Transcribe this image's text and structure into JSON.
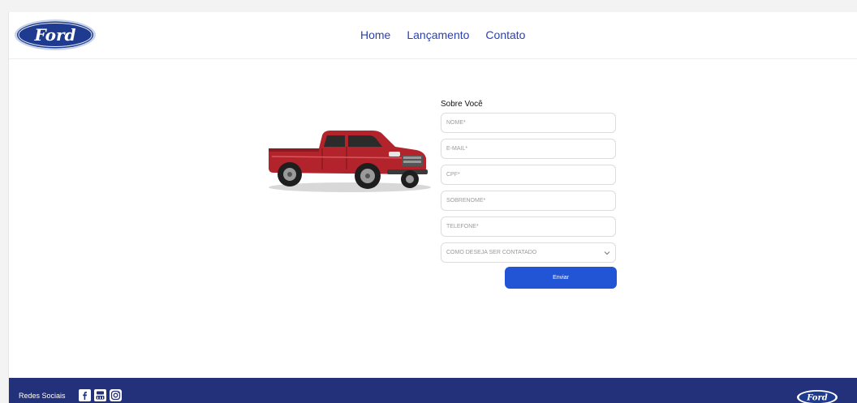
{
  "header": {
    "logo_text": "Ford",
    "nav": [
      "Home",
      "Lançamento",
      "Contato"
    ]
  },
  "form": {
    "title": "Sobre Você",
    "fields": [
      {
        "placeholder": "NOME*"
      },
      {
        "placeholder": "E-MAIL*"
      },
      {
        "placeholder": "CPF*"
      },
      {
        "placeholder": "SOBRENOME*"
      },
      {
        "placeholder": "TELEFONE*"
      }
    ],
    "select_value": "COMO DESEJA SER CONTATADO",
    "submit_label": "Enviar"
  },
  "footer": {
    "label": "Redes Sociais",
    "icons": [
      "facebook-icon",
      "youtube-icon",
      "instagram-icon"
    ],
    "logo_text": "Ford"
  },
  "colors": {
    "brand_blue": "#23307a",
    "nav_link": "#2a3fb8",
    "button": "#2155d6",
    "truck_red": "#b3232b"
  }
}
